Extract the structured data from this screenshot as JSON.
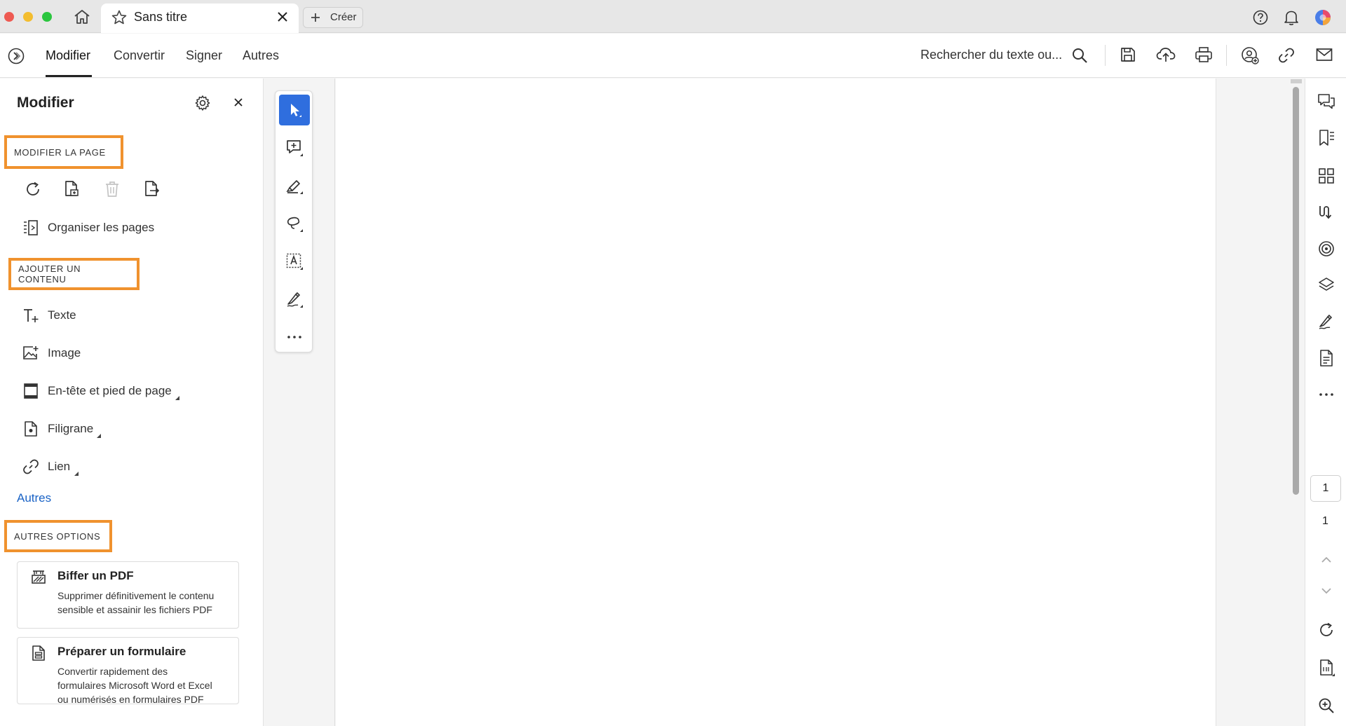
{
  "window": {
    "tab_title": "Sans titre",
    "create_label": "Créer"
  },
  "toolbar": {
    "tabs": [
      {
        "label": "Modifier",
        "active": true
      },
      {
        "label": "Convertir",
        "active": false
      },
      {
        "label": "Signer",
        "active": false
      },
      {
        "label": "Autres",
        "active": false
      }
    ],
    "search_label": "Rechercher du texte ou..."
  },
  "left_panel": {
    "title": "Modifier",
    "section_modify_page": "MODIFIER LA PAGE",
    "page_icons": [
      "rotate-icon",
      "insert-page-icon",
      "delete-page-icon",
      "extract-page-icon"
    ],
    "organize_label": "Organiser les pages",
    "section_add_content": "AJOUTER UN CONTENU",
    "add_items": [
      {
        "label": "Texte",
        "icon": "add-text-icon"
      },
      {
        "label": "Image",
        "icon": "add-image-icon"
      },
      {
        "label": "En-tête et pied de page",
        "icon": "header-footer-icon"
      },
      {
        "label": "Filigrane",
        "icon": "watermark-icon"
      },
      {
        "label": "Lien",
        "icon": "link-icon"
      }
    ],
    "more_link": "Autres",
    "section_other_options": "AUTRES OPTIONS",
    "cards": [
      {
        "title": "Biffer un PDF",
        "description": "Supprimer définitivement le contenu sensible et assainir les fichiers PDF",
        "icon": "redact-icon"
      },
      {
        "title": "Préparer un formulaire",
        "description": "Convertir rapidement des formulaires Microsoft Word et Excel ou numérisés en formulaires PDF",
        "icon": "form-icon"
      }
    ]
  },
  "quick_tools": [
    "select-icon",
    "add-comment-icon",
    "highlight-icon",
    "draw-icon",
    "text-box-icon",
    "sign-icon",
    "more-icon"
  ],
  "right_rail": {
    "icons": [
      "comments-icon",
      "bookmarks-icon",
      "thumbnails-icon",
      "compare-icon",
      "protect-icon",
      "layers-icon",
      "fill-sign-icon",
      "document-icon",
      "more-icon"
    ],
    "current_page": "1",
    "total_pages": "1"
  },
  "colors": {
    "accent": "#2f6ede",
    "highlight_outline": "#f0922e",
    "link": "#1a63c6"
  }
}
